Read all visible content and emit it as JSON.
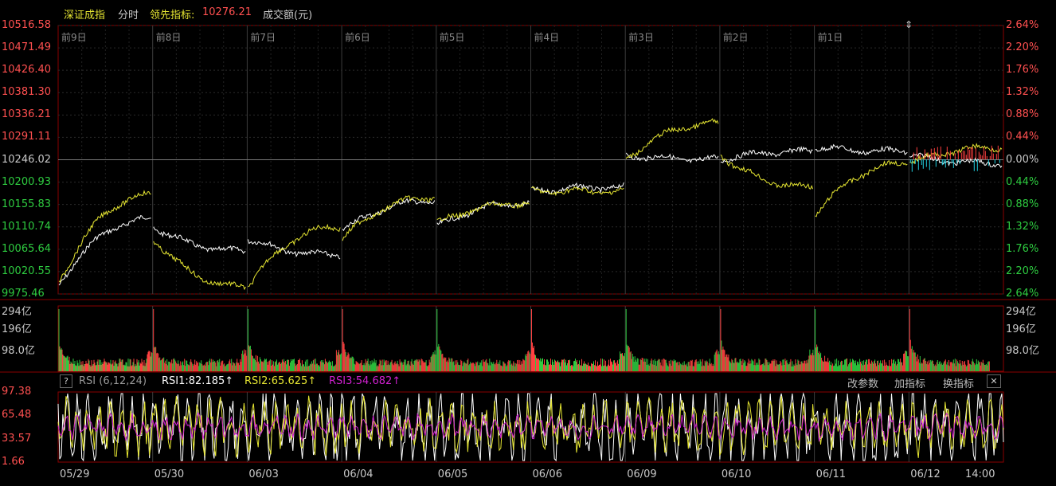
{
  "header": {
    "index_name": "深证成指",
    "mode": "分时",
    "leading_label": "领先指标:",
    "leading_value": "10276.21",
    "volume_label": "成交额(元)"
  },
  "price_axis_left": [
    "10516.58",
    "10471.49",
    "10426.40",
    "10381.30",
    "10336.21",
    "10291.11",
    "10246.02",
    "10200.93",
    "10155.83",
    "10110.74",
    "10065.64",
    "10020.55",
    "9975.46"
  ],
  "price_axis_right": [
    "2.64%",
    "2.20%",
    "1.76%",
    "1.32%",
    "0.88%",
    "0.44%",
    "0.00%",
    "0.44%",
    "0.88%",
    "1.32%",
    "1.76%",
    "2.20%",
    "2.64%"
  ],
  "day_labels": [
    "前9日",
    "前8日",
    "前7日",
    "前6日",
    "前5日",
    "前4日",
    "前3日",
    "前2日",
    "前1日"
  ],
  "volume_axis": [
    "294亿",
    "196亿",
    "98.0亿"
  ],
  "rsi": {
    "help": "?",
    "title": "RSI (6,12,24)",
    "rsi1": "RSI1:82.185↑",
    "rsi2": "RSI2:65.625↑",
    "rsi3": "RSI3:54.682↑",
    "btn_params": "改参数",
    "btn_add": "加指标",
    "btn_swap": "换指标",
    "close": "✕",
    "axis": [
      "97.38",
      "65.48",
      "33.57",
      "1.66"
    ]
  },
  "dates": [
    "05/29",
    "05/30",
    "06/03",
    "06/04",
    "06/05",
    "06/06",
    "06/09",
    "06/10",
    "06/11",
    "06/12",
    "14:00"
  ],
  "colors": {
    "up": "#ff4040",
    "down": "#2ecc40",
    "yellow": "#e6e632",
    "white": "#ffffff",
    "magenta": "#d020d0",
    "cyan": "#20d0e0",
    "grid": "#3a0000"
  }
}
